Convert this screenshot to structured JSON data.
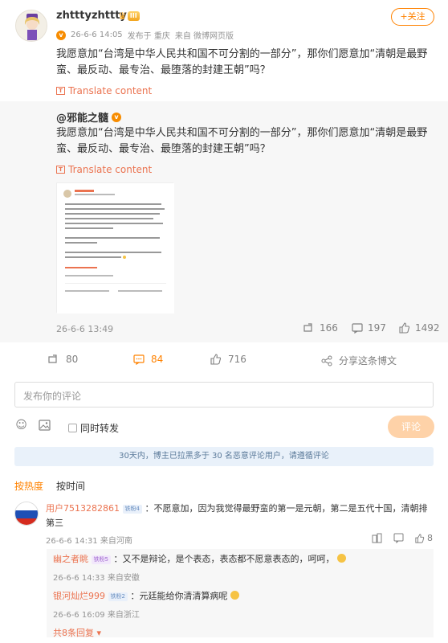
{
  "post": {
    "author": "zhtttyzhttty",
    "vip_level": "III",
    "follow_label": "+关注",
    "date": "26-6-6 14:05",
    "location": "发布于 重庆",
    "source": "来自 微博网页版",
    "text": "我愿意加“台湾是中华人民共和国不可分割的一部分”，那你们愿意加“清朝是最野蛮、最反动、最专治、最堕落的封建王朝”吗？",
    "translate_label": "Translate content"
  },
  "repost": {
    "author": "@邪能之髓",
    "text": "我愿意加“台湾是中华人民共和国不可分割的一部分”，那你们愿意加“清朝是最野蛮、最反动、最专治、最堕落的封建王朝”吗？",
    "translate_label": "Translate content",
    "date": "26-6-6 13:49",
    "reposts": "166",
    "comments": "197",
    "likes": "1492"
  },
  "actions": {
    "repost_count": "80",
    "comment_count": "84",
    "like_count": "716",
    "share_label": "分享这条博文"
  },
  "comment_form": {
    "placeholder": "发布你的评论",
    "repost_label": "同时转发",
    "submit_label": "评论"
  },
  "notice": "30天内，博主已拉黑多于 30 名恶意评论用户，请遵循评论",
  "sort_tabs": [
    "按热度",
    "按时间"
  ],
  "comments": [
    {
      "user": "用户7513282861",
      "badge": "铁粉4",
      "text": "：不愿意加，因为我觉得最野蛮的第一是元朝，第二是五代十国，清朝排第三",
      "date": "26-6-6 14:31",
      "source": "来自河南",
      "likes": "8",
      "replies": [
        {
          "user": "幽之者眺",
          "badge": "铁粉5",
          "text": "：又不是辩论，是个表态，表态都不愿意表态的，呵呵，",
          "date": "26-6-6 14:33",
          "source": "来自安徽"
        },
        {
          "user": "银河灿烂999",
          "badge": "铁粉2",
          "text": "：元廷能给你清清算病呢",
          "date": "26-6-6 16:09",
          "source": "来自浙江"
        }
      ],
      "more_replies_label": "共8条回复"
    }
  ],
  "colors": {
    "accent_orange": "#ff8200",
    "link": "#eb7350",
    "muted": "#939393",
    "card_bg": "#f7f7f7"
  }
}
